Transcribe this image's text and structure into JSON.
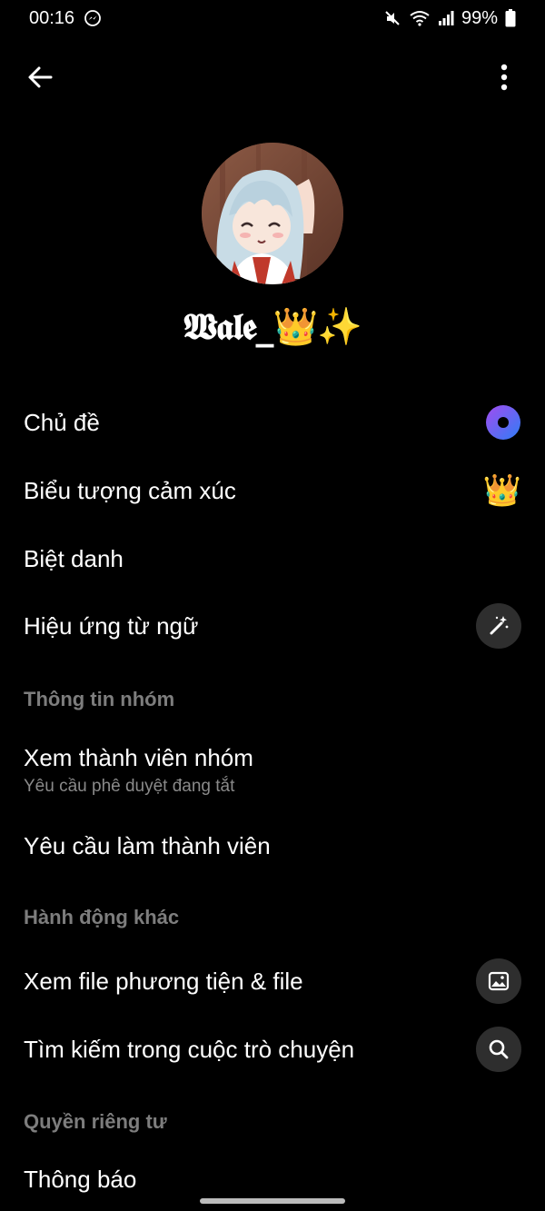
{
  "status_bar": {
    "time": "00:16",
    "battery": "99%",
    "icons": [
      "messenger-icon",
      "mute-icon",
      "wifi-icon",
      "signal-icon",
      "battery-icon"
    ]
  },
  "top_bar": {
    "back_icon": "arrow-left-icon",
    "more_icon": "more-vertical-icon"
  },
  "profile": {
    "name": "𝖂𝖆𝖑𝖊_👑✨"
  },
  "menu": {
    "theme": {
      "label": "Chủ đề",
      "icon": "theme-circle-icon"
    },
    "emoji": {
      "label": "Biểu tượng cảm xúc",
      "value": "👑"
    },
    "nicknames": {
      "label": "Biệt danh"
    },
    "word_effects": {
      "label": "Hiệu ứng từ ngữ",
      "icon": "magic-wand-icon"
    }
  },
  "sections": {
    "group_info": "Thông tin nhóm",
    "other_actions": "Hành động khác",
    "privacy": "Quyền riêng tư"
  },
  "group_info": {
    "view_members": {
      "label": "Xem thành viên nhóm",
      "sublabel": "Yêu cầu phê duyệt đang tắt"
    },
    "membership_requests": {
      "label": "Yêu cầu làm thành viên"
    }
  },
  "other_actions": {
    "view_media": {
      "label": "Xem file phương tiện & file",
      "icon": "image-icon"
    },
    "search": {
      "label": "Tìm kiếm trong cuộc trò chuyện",
      "icon": "search-icon"
    }
  },
  "privacy": {
    "notifications": {
      "label": "Thông báo"
    }
  },
  "colors": {
    "background": "#000000",
    "text": "#ffffff",
    "muted": "#7d7d7d",
    "circle_button": "#2e2e2e",
    "theme_gradient_start": "#a24cf0",
    "theme_gradient_end": "#2f7df5"
  }
}
